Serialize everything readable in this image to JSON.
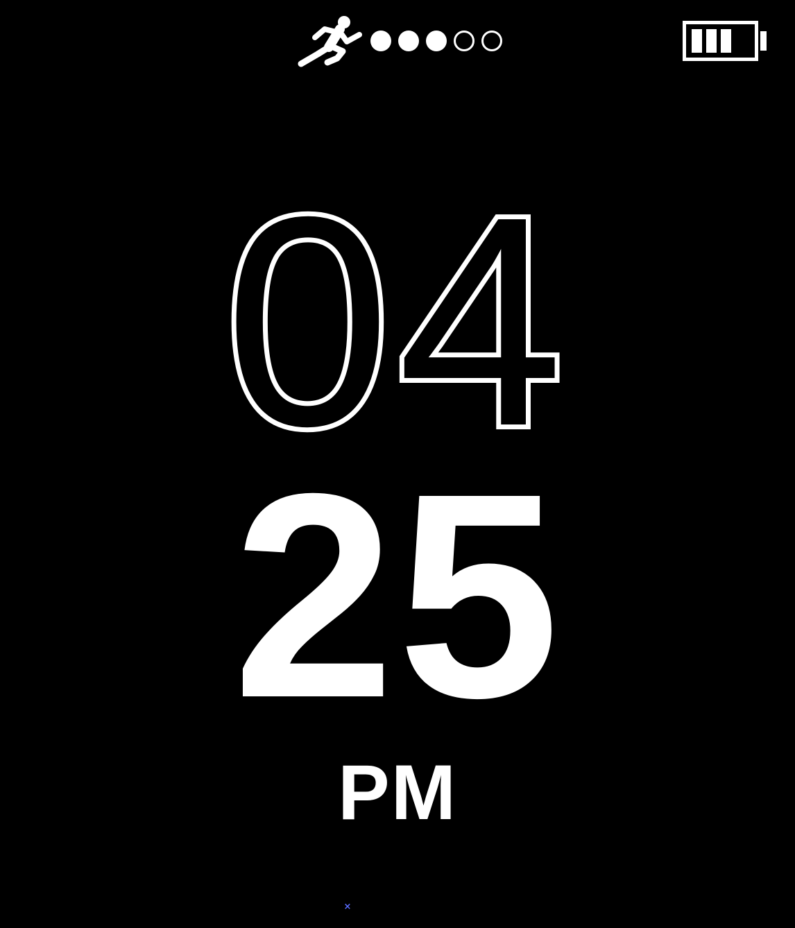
{
  "status_bar": {
    "activity_icon": "running-person-icon",
    "goal_progress": {
      "filled": 3,
      "total": 5
    },
    "battery_icon": "battery-icon",
    "battery_level": 0.75
  },
  "clock": {
    "hours": "04",
    "minutes": "25",
    "ampm": "PM"
  },
  "footer": {
    "close_symbol": "×"
  },
  "colors": {
    "background": "#000000",
    "foreground": "#ffffff",
    "accent": "#5a6cff"
  }
}
